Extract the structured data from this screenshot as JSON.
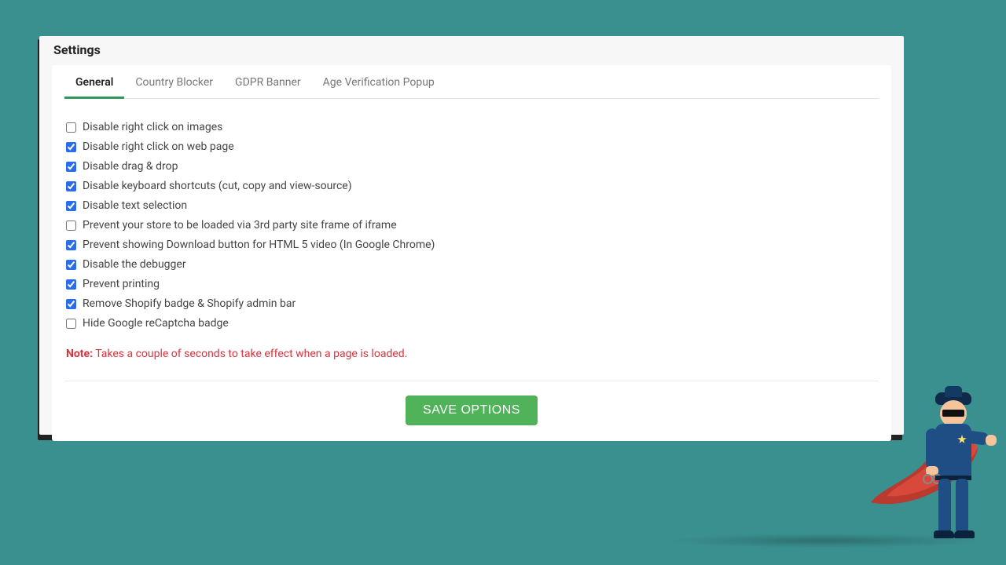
{
  "title": "Settings",
  "tabs": [
    {
      "label": "General",
      "active": true
    },
    {
      "label": "Country Blocker",
      "active": false
    },
    {
      "label": "GDPR Banner",
      "active": false
    },
    {
      "label": "Age Verification Popup",
      "active": false
    }
  ],
  "options": [
    {
      "label": "Disable right click on images",
      "checked": false
    },
    {
      "label": "Disable right click on web page",
      "checked": true
    },
    {
      "label": "Disable drag & drop",
      "checked": true
    },
    {
      "label": "Disable keyboard shortcuts (cut, copy and view-source)",
      "checked": true
    },
    {
      "label": "Disable text selection",
      "checked": true
    },
    {
      "label": "Prevent your store to be loaded via 3rd party site frame of iframe",
      "checked": false
    },
    {
      "label": "Prevent showing Download button for HTML 5 video (In Google Chrome)",
      "checked": true
    },
    {
      "label": "Disable the debugger",
      "checked": true
    },
    {
      "label": "Prevent printing",
      "checked": true
    },
    {
      "label": "Remove Shopify badge & Shopify admin bar",
      "checked": true
    },
    {
      "label": "Hide Google reCaptcha badge",
      "checked": false
    }
  ],
  "note": {
    "label": "Note:",
    "text": " Takes a couple of seconds to take effect when a page is loaded."
  },
  "buttons": {
    "save": "SAVE OPTIONS"
  },
  "colors": {
    "accent": "#50b35a",
    "tab_underline": "#2e9b5a",
    "note": "#d9333f"
  }
}
